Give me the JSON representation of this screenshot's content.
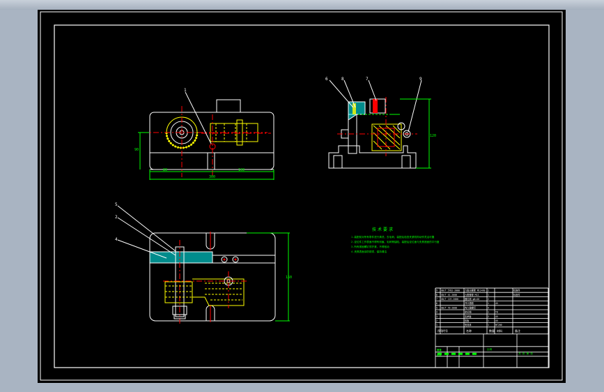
{
  "drawing": {
    "technical_requirements": {
      "title": "技术要求",
      "lines": [
        "1.装配前对所有零件进行清洗，去毛刺，装配后检查夹紧机构动作灵活可靠",
        "2.定位件工作表面不得有划痕、毛刺等缺陷，装配后定位面与夹具底面的平行度",
        "3.所有紧固螺钉须拧紧，不得松动",
        "4.夹具表面涂防锈漆，保持清洁"
      ]
    },
    "balloons": {
      "front_view": [
        "1"
      ],
      "side_view": [
        "6",
        "8",
        "7",
        "9"
      ],
      "top_view": [
        "5",
        "2",
        "4"
      ]
    },
    "dimensions": {
      "front_overall_width": "300",
      "front_left_offset": "80",
      "front_right_offset": "160",
      "front_height": "90",
      "side_height": "120",
      "top_depth": "150"
    },
    "title_block": {
      "parts_rows": [
        [
          "9",
          "GB/T 5782-2000",
          "六角头螺栓 M12×60",
          "1",
          "",
          "标准件"
        ],
        [
          "8",
          "GB/T 41-2000",
          "六角螺母 M12",
          "1",
          "",
          "标准件"
        ],
        [
          "7",
          "GB/T 119-2000",
          "圆柱销 φ8×40",
          "2",
          "",
          ""
        ],
        [
          "6",
          "",
          "开口垫圈",
          "1",
          "45",
          ""
        ],
        [
          "5",
          "GB/T 70-2000",
          "内六角螺钉",
          "4",
          "",
          ""
        ],
        [
          "4",
          "",
          "定位销",
          "1",
          "T8",
          ""
        ],
        [
          "3",
          "",
          "支承板",
          "2",
          "45",
          ""
        ],
        [
          "2",
          "",
          "压板",
          "1",
          "45",
          ""
        ],
        [
          "1",
          "",
          "夹具体",
          "1",
          "HT200",
          ""
        ]
      ],
      "header": [
        "序号",
        "代号",
        "名称",
        "数量",
        "材料",
        "备注"
      ],
      "bottom_labels": [
        "设计",
        "审核",
        "工艺",
        "批准"
      ],
      "scale_label": "比例",
      "sheet_label": "共 张 第 张"
    }
  }
}
